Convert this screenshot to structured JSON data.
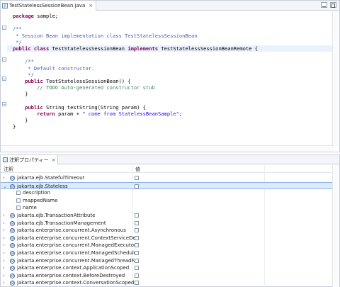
{
  "editor": {
    "tab_label": "TestStatelessSessionBean.java",
    "tab_close": "×",
    "code_lines": [
      [
        {
          "t": "package",
          "c": "kw"
        },
        {
          "t": " sample;",
          "c": ""
        }
      ],
      [],
      [
        {
          "t": "/**",
          "c": "jd"
        }
      ],
      [
        {
          "t": " * Session Bean implementation class TestStatelessSessionBean",
          "c": "jd"
        }
      ],
      [
        {
          "t": " */",
          "c": "jd"
        }
      ],
      [
        {
          "t": "public",
          "c": "kw"
        },
        {
          "t": " ",
          "c": ""
        },
        {
          "t": "class",
          "c": "kw"
        },
        {
          "t": " TestStatelessSessionBean ",
          "c": ""
        },
        {
          "t": "implements",
          "c": "kw"
        },
        {
          "t": " TestStatelessSessionBeanRemote {",
          "c": ""
        }
      ],
      [],
      [
        {
          "t": "    /**",
          "c": "jd"
        }
      ],
      [
        {
          "t": "     * Default constructor.",
          "c": "jd"
        }
      ],
      [
        {
          "t": "     */",
          "c": "jd"
        }
      ],
      [
        {
          "t": "    ",
          "c": ""
        },
        {
          "t": "public",
          "c": "kw"
        },
        {
          "t": " TestStatelessSessionBean() {",
          "c": ""
        }
      ],
      [
        {
          "t": "        // ",
          "c": "cm"
        },
        {
          "t": "TODO",
          "c": "cm"
        },
        {
          "t": " Auto-generated constructor stub",
          "c": "cm"
        }
      ],
      [
        {
          "t": "    }",
          "c": ""
        }
      ],
      [],
      [
        {
          "t": "    ",
          "c": ""
        },
        {
          "t": "public",
          "c": "kw"
        },
        {
          "t": " String testString(String param) {",
          "c": ""
        }
      ],
      [
        {
          "t": "        ",
          "c": ""
        },
        {
          "t": "return",
          "c": "kw"
        },
        {
          "t": " param + ",
          "c": ""
        },
        {
          "t": "\" come from StatelessBeanSample\"",
          "c": "str"
        },
        {
          "t": ";",
          "c": ""
        }
      ],
      [
        {
          "t": "    }",
          "c": ""
        }
      ],
      [
        {
          "t": "}",
          "c": ""
        }
      ]
    ]
  },
  "properties": {
    "tab_label": "注釈プロパティー",
    "tab_close": "×",
    "col_annotation": "注釈",
    "col_value": "値",
    "rows": [
      {
        "label": "jakarta.ejb.StatefulTimeout",
        "kind": "annotation",
        "twisty": "›",
        "checkbox": true,
        "selected": false
      },
      {
        "label": "jakarta.ejb.Stateless",
        "kind": "annotation",
        "twisty": "⌄",
        "checkbox": true,
        "selected": true
      },
      {
        "label": "description",
        "kind": "attribute",
        "twisty": "",
        "checkbox": false,
        "selected": false
      },
      {
        "label": "mappedName",
        "kind": "attribute",
        "twisty": "",
        "checkbox": false,
        "selected": false
      },
      {
        "label": "name",
        "kind": "attribute",
        "twisty": "",
        "checkbox": false,
        "selected": false
      },
      {
        "label": "jakarta.ejb.TransactionAttribute",
        "kind": "annotation",
        "twisty": "›",
        "checkbox": true,
        "selected": false
      },
      {
        "label": "jakarta.ejb.TransactionManagement",
        "kind": "annotation",
        "twisty": "›",
        "checkbox": true,
        "selected": false
      },
      {
        "label": "jakarta.enterprise.concurrent.Asynchronous",
        "kind": "annotation",
        "twisty": "›",
        "checkbox": true,
        "selected": false
      },
      {
        "label": "jakarta.enterprise.concurrent.ContextServiceDefinition",
        "kind": "annotation",
        "twisty": "›",
        "checkbox": true,
        "selected": false
      },
      {
        "label": "jakarta.enterprise.concurrent.ManagedExecutorDefinit",
        "kind": "annotation",
        "twisty": "›",
        "checkbox": true,
        "selected": false
      },
      {
        "label": "jakarta.enterprise.concurrent.ManagedScheduledExecu",
        "kind": "annotation",
        "twisty": "›",
        "checkbox": true,
        "selected": false
      },
      {
        "label": "jakarta.enterprise.concurrent.ManagedThreadFactoryD",
        "kind": "annotation",
        "twisty": "›",
        "checkbox": true,
        "selected": false
      },
      {
        "label": "jakarta.enterprise.context.ApplicationScoped",
        "kind": "annotation",
        "twisty": "›",
        "checkbox": true,
        "selected": false
      },
      {
        "label": "jakarta.enterprise.context.BeforeDestroyed",
        "kind": "annotation",
        "twisty": "›",
        "checkbox": true,
        "selected": false
      },
      {
        "label": "jakarta.enterprise.context.ConversationScoped",
        "kind": "annotation",
        "twisty": "›",
        "checkbox": true,
        "selected": false
      }
    ]
  },
  "colors": {
    "keyword": "#7f0055",
    "javadoc": "#3f5fbf",
    "comment": "#3f7f5f",
    "string": "#2a00ff",
    "line_highlight": "#e8f2fe",
    "selection": "#dcebfb"
  }
}
